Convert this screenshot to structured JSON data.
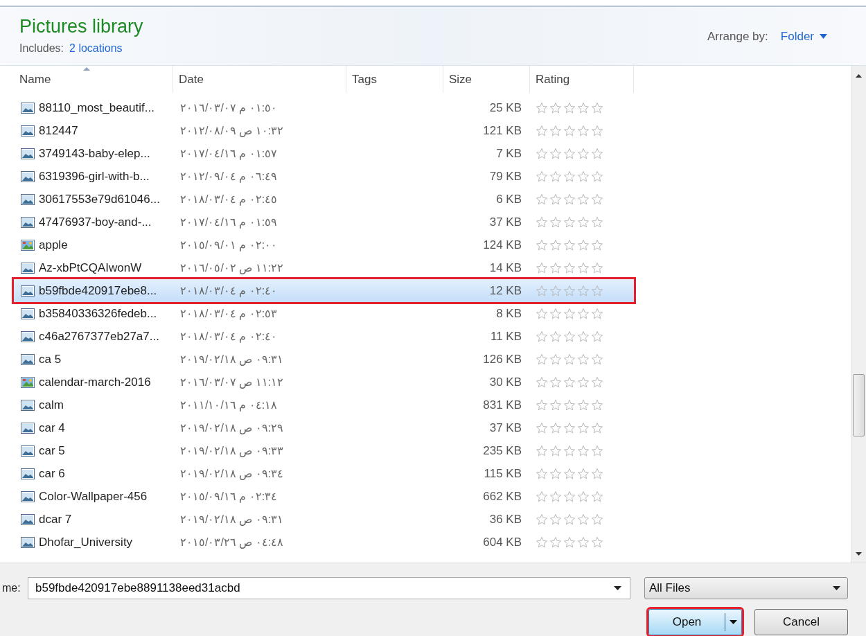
{
  "header": {
    "title": "Pictures library",
    "includes_label": "Includes:",
    "includes_link": "2 locations",
    "arrange_label": "Arrange by:",
    "arrange_value": "Folder"
  },
  "columns": [
    {
      "label": "Name",
      "sorted": true
    },
    {
      "label": "Date",
      "sorted": false
    },
    {
      "label": "Tags",
      "sorted": false
    },
    {
      "label": "Size",
      "sorted": false
    },
    {
      "label": "Rating",
      "sorted": false
    }
  ],
  "rows": [
    {
      "name": "88110_most_beautif...",
      "kind": "image",
      "date": "٢٠١٦/٠٣/٠٧ م ٠١:٥٠",
      "size": "25 KB",
      "stars": 0,
      "selected": false
    },
    {
      "name": "812447",
      "kind": "image",
      "date": "٢٠١٢/٠٨/٠٩ ص ١٠:٣٢",
      "size": "121 KB",
      "stars": 0,
      "selected": false
    },
    {
      "name": "3749143-baby-elep...",
      "kind": "image",
      "date": "٢٠١٧/٠٤/١٦ م ٠١:٥٧",
      "size": "7 KB",
      "stars": 0,
      "selected": false
    },
    {
      "name": "6319396-girl-with-b...",
      "kind": "image",
      "date": "٢٠١٢/٠٩/٠٤ م ٠٦:٤٩",
      "size": "79 KB",
      "stars": 0,
      "selected": false
    },
    {
      "name": "30617553e79d61046...",
      "kind": "image",
      "date": "٢٠١٨/٠٣/٠٤ م ٠٢:٤٥",
      "size": "6 KB",
      "stars": 0,
      "selected": false
    },
    {
      "name": "47476937-boy-and-...",
      "kind": "image",
      "date": "٢٠١٧/٠٤/١٦ م ٠١:٥٩",
      "size": "37 KB",
      "stars": 0,
      "selected": false
    },
    {
      "name": "apple",
      "kind": "bitmap",
      "date": "٢٠١٥/٠٩/٠١ م ٠٢:٠٠",
      "size": "124 KB",
      "stars": 0,
      "selected": false
    },
    {
      "name": "Az-xbPtCQAIwonW",
      "kind": "image",
      "date": "٢٠١٦/٠٥/٠٢ ص ١١:٢٢",
      "size": "14 KB",
      "stars": 0,
      "selected": false
    },
    {
      "name": "b59fbde420917ebe8...",
      "kind": "image",
      "date": "٢٠١٨/٠٣/٠٤ م ٠٢:٤٠",
      "size": "12 KB",
      "stars": 0,
      "selected": true
    },
    {
      "name": "b35840336326fedeb...",
      "kind": "image",
      "date": "٢٠١٨/٠٣/٠٤ م ٠٢:٥٣",
      "size": "8 KB",
      "stars": 0,
      "selected": false
    },
    {
      "name": "c46a2767377eb27a7...",
      "kind": "image",
      "date": "٢٠١٨/٠٣/٠٤ م ٠٢:٤٠",
      "size": "11 KB",
      "stars": 0,
      "selected": false
    },
    {
      "name": "ca 5",
      "kind": "image",
      "date": "٢٠١٩/٠٢/١٨ ص ٠٩:٣١",
      "size": "126 KB",
      "stars": 0,
      "selected": false
    },
    {
      "name": "calendar-march-2016",
      "kind": "bitmap",
      "date": "٢٠١٦/٠٣/٠٧ ص ١١:١٢",
      "size": "30 KB",
      "stars": 0,
      "selected": false
    },
    {
      "name": "calm",
      "kind": "image",
      "date": "٢٠١١/١٠/١٦ م ٠٤:١٨",
      "size": "831 KB",
      "stars": 0,
      "selected": false
    },
    {
      "name": "car 4",
      "kind": "image",
      "date": "٢٠١٩/٠٢/١٨ ص ٠٩:٢٩",
      "size": "37 KB",
      "stars": 0,
      "selected": false
    },
    {
      "name": "car 5",
      "kind": "image",
      "date": "٢٠١٩/٠٢/١٨ ص ٠٩:٣٣",
      "size": "235 KB",
      "stars": 0,
      "selected": false
    },
    {
      "name": "car 6",
      "kind": "image",
      "date": "٢٠١٩/٠٢/١٨ ص ٠٩:٣٤",
      "size": "115 KB",
      "stars": 0,
      "selected": false
    },
    {
      "name": "Color-Wallpaper-456",
      "kind": "image",
      "date": "٢٠١٥/٠٩/١٦ م ٠٢:٣٤",
      "size": "662 KB",
      "stars": 0,
      "selected": false
    },
    {
      "name": "dcar 7",
      "kind": "image",
      "date": "٢٠١٩/٠٢/١٨ ص ٠٩:٣١",
      "size": "36 KB",
      "stars": 0,
      "selected": false
    },
    {
      "name": "Dhofar_University",
      "kind": "image",
      "date": "٢٠١٥/٠٣/٢٦ ص ٠٤:٤٨",
      "size": "604 KB",
      "stars": 0,
      "selected": false
    }
  ],
  "file_name": {
    "label": "me:",
    "value": "b59fbde420917ebe8891138eed31acbd"
  },
  "file_type": {
    "value": "All Files"
  },
  "buttons": [
    {
      "label": "Open",
      "kind": "split",
      "outlined": true
    },
    {
      "label": "Cancel",
      "kind": "plain",
      "outlined": false
    }
  ]
}
